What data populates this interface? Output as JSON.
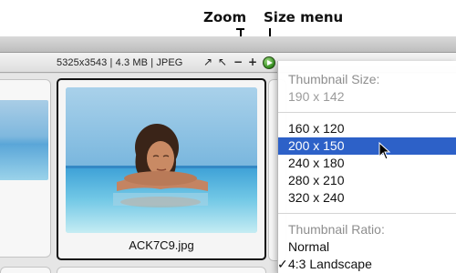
{
  "callouts": {
    "zoom": "Zoom",
    "size_menu": "Size menu"
  },
  "statusbar": {
    "info": "5325x3543 | 4.3 MB | JPEG",
    "icons": [
      "expand-arrow-icon",
      "shrink-arrow-icon",
      "zoom-out-icon",
      "zoom-in-icon",
      "size-menu-button-icon"
    ],
    "glyphs": {
      "expand": "↗",
      "shrink": "↖",
      "minus": "−",
      "plus": "+"
    }
  },
  "thumbnail": {
    "filename": "ACK7C9.jpg",
    "selected": true
  },
  "size_menu": {
    "header": "Thumbnail Size:",
    "current": "190 x 142",
    "sizes": [
      "160 x 120",
      "200 x 150",
      "240 x 180",
      "280 x 210",
      "320 x 240"
    ],
    "highlighted": "200 x 150",
    "ratio_header": "Thumbnail Ratio:",
    "ratios": [
      "Normal",
      "4:3 Landscape"
    ],
    "checked_ratio": "4:3 Landscape"
  },
  "colors": {
    "highlight": "#2d61c8",
    "menu_button": "#2f8a1a"
  }
}
